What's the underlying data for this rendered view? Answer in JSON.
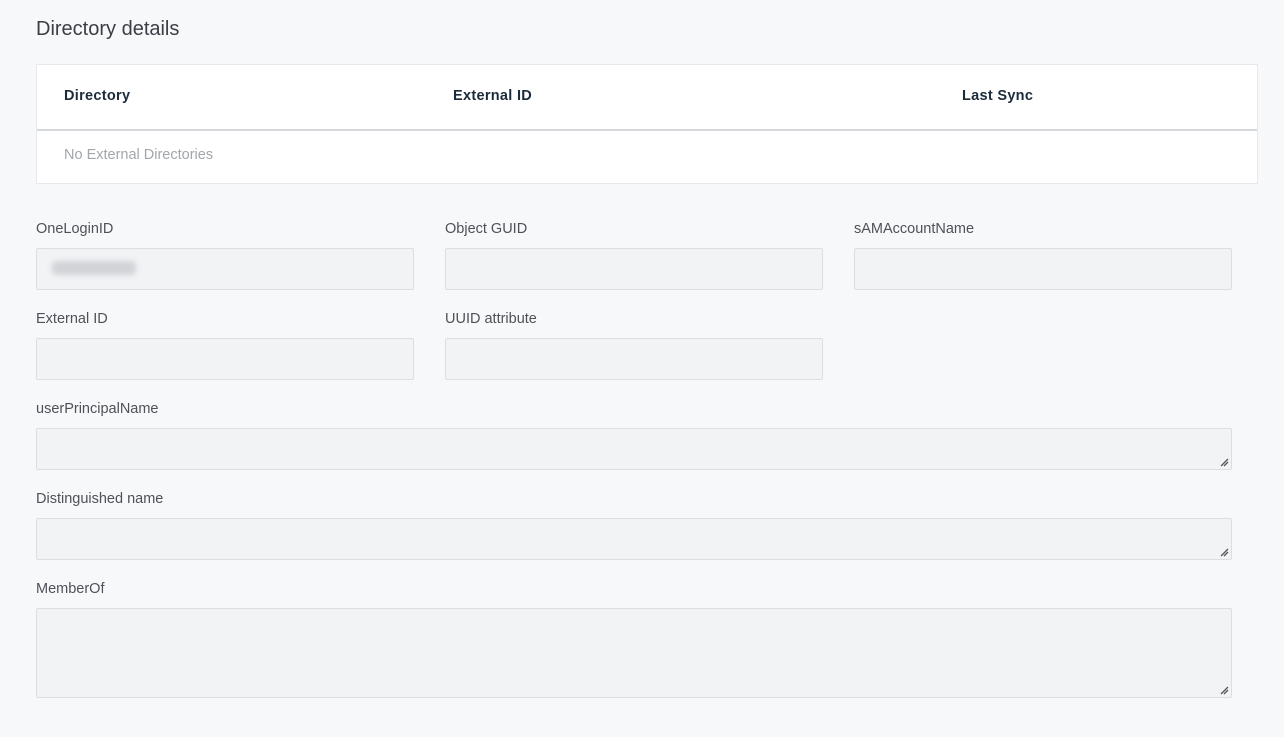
{
  "section": {
    "title": "Directory details"
  },
  "directories_table": {
    "columns": [
      "Directory",
      "External ID",
      "Last Sync"
    ],
    "rows": [],
    "empty_message": "No External Directories"
  },
  "fields": {
    "onelogin_id": {
      "label": "OneLoginID",
      "value": "[redacted]"
    },
    "object_guid": {
      "label": "Object GUID",
      "value": ""
    },
    "samaccountname": {
      "label": "sAMAccountName",
      "value": ""
    },
    "external_id": {
      "label": "External ID",
      "value": ""
    },
    "uuid_attribute": {
      "label": "UUID attribute",
      "value": ""
    },
    "user_principal_name": {
      "label": "userPrincipalName",
      "value": ""
    },
    "distinguished_name": {
      "label": "Distinguished name",
      "value": ""
    },
    "member_of": {
      "label": "MemberOf",
      "value": ""
    }
  }
}
